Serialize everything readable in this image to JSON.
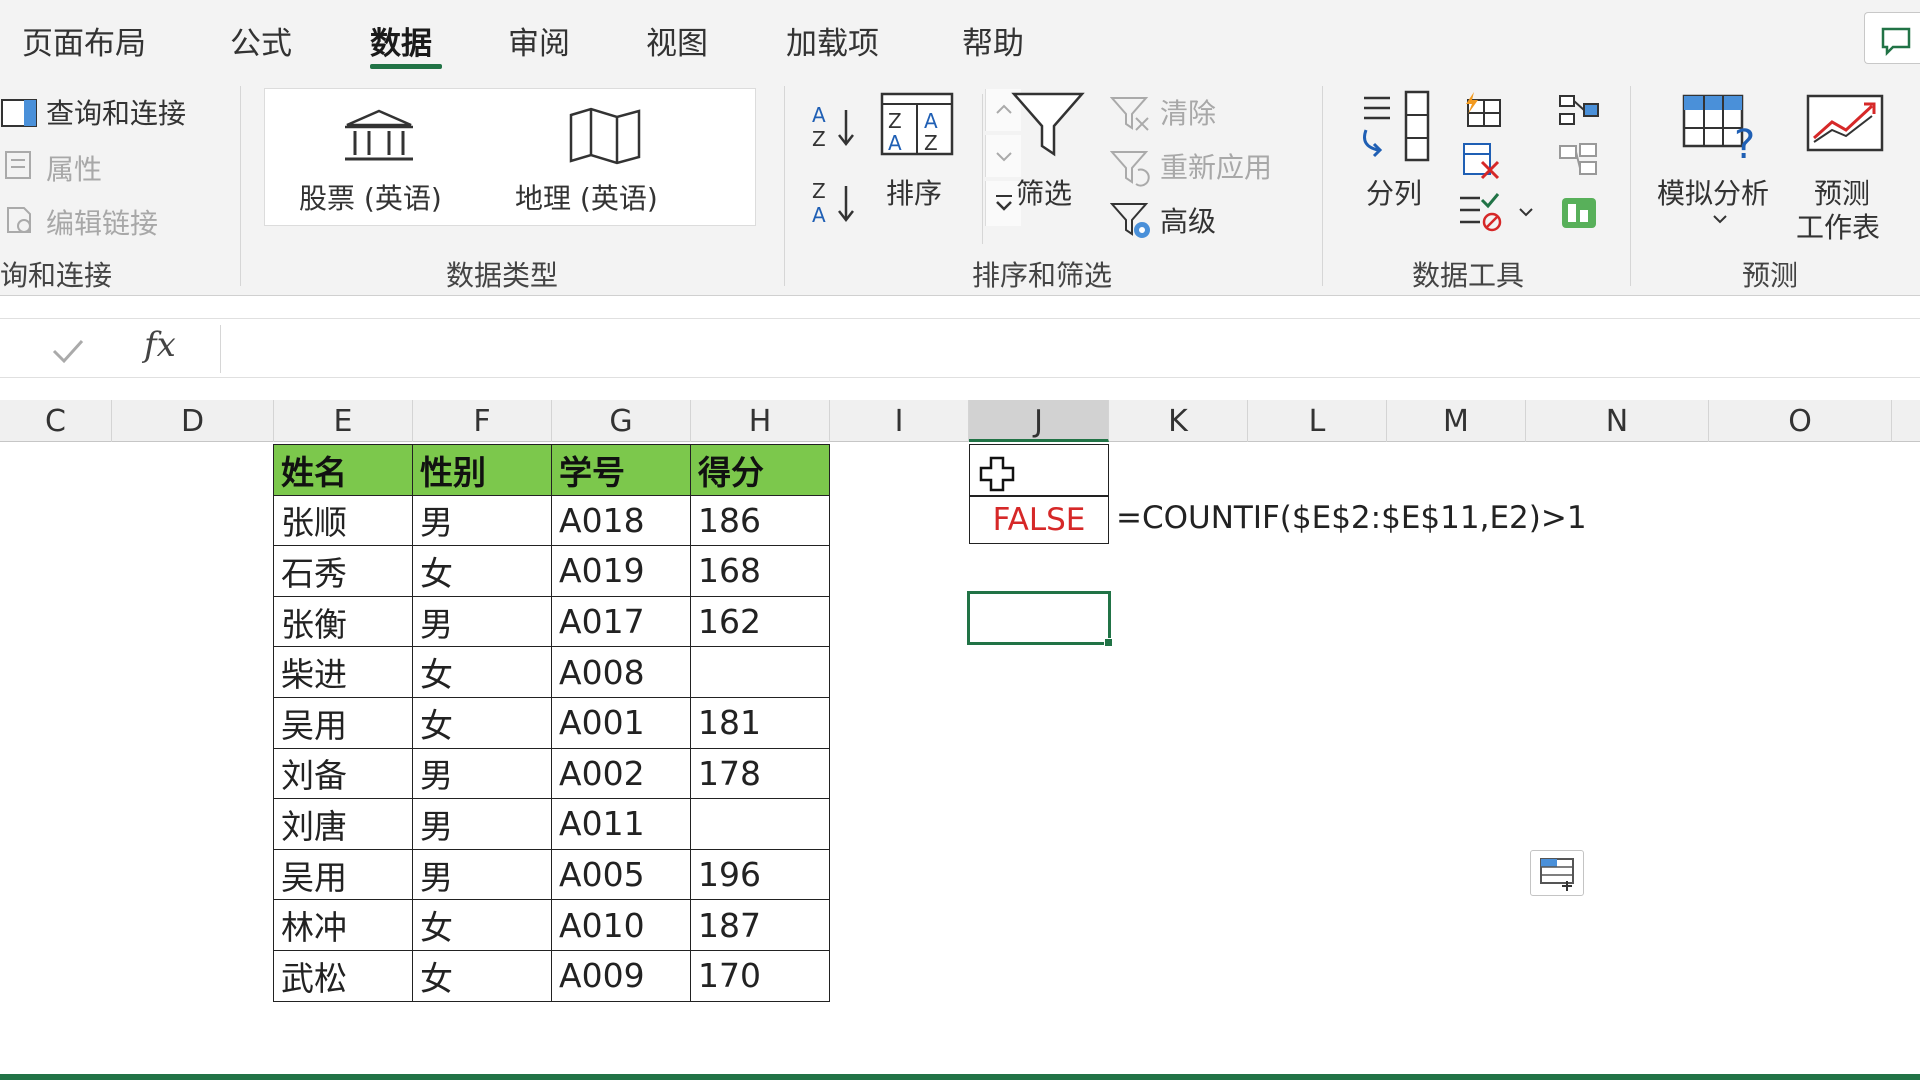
{
  "ribbon_tabs": {
    "items": [
      "页面布局",
      "公式",
      "数据",
      "审阅",
      "视图",
      "加载项",
      "帮助"
    ],
    "active": "数据"
  },
  "ribbon": {
    "queries": {
      "items": [
        "查询和连接",
        "属性",
        "编辑链接"
      ],
      "group_label": "询和连接"
    },
    "data_types": {
      "stocks": "股票 (英语)",
      "geography": "地理 (英语)",
      "group_label": "数据类型"
    },
    "sort_filter": {
      "sort": "排序",
      "filter": "筛选",
      "clear": "清除",
      "reapply": "重新应用",
      "advanced": "高级",
      "group_label": "排序和筛选"
    },
    "data_tools": {
      "text_to_columns": "分列",
      "group_label": "数据工具"
    },
    "forecast": {
      "what_if": "模拟分析",
      "forecast_sheet_line1": "预测",
      "forecast_sheet_line2": "工作表",
      "group_label": "预测"
    }
  },
  "formula_bar": {
    "fx": "fx",
    "value": ""
  },
  "columns": [
    "C",
    "D",
    "E",
    "F",
    "G",
    "H",
    "I",
    "J",
    "K",
    "L",
    "M",
    "N",
    "O"
  ],
  "selected_column": "J",
  "table": {
    "headers": [
      "姓名",
      "性别",
      "学号",
      "得分"
    ],
    "rows": [
      [
        "张顺",
        "男",
        "A018",
        "186"
      ],
      [
        "石秀",
        "女",
        "A019",
        "168"
      ],
      [
        "张衡",
        "男",
        "A017",
        "162"
      ],
      [
        "柴进",
        "女",
        "A008",
        ""
      ],
      [
        "吴用",
        "女",
        "A001",
        "181"
      ],
      [
        "刘备",
        "男",
        "A002",
        "178"
      ],
      [
        "刘唐",
        "男",
        "A011",
        ""
      ],
      [
        "吴用",
        "男",
        "A005",
        "196"
      ],
      [
        "林冲",
        "女",
        "A010",
        "187"
      ],
      [
        "武松",
        "女",
        "A009",
        "170"
      ]
    ]
  },
  "cells": {
    "j3_value": "FALSE",
    "formula_note": "=COUNTIF($E$2:$E$11,E2)>1"
  },
  "colors": {
    "accent": "#217346",
    "header_fill": "#7cc84c",
    "false_text": "#d62828"
  }
}
